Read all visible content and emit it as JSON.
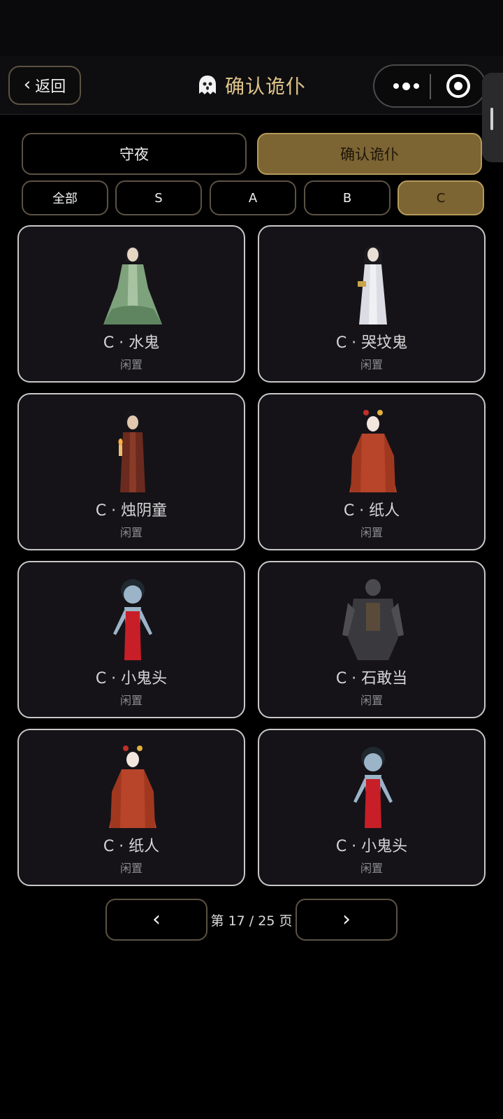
{
  "nav": {
    "back_icon": "‹",
    "back_label": "返回",
    "title": "确认诡仆",
    "title_icon": "ghost-icon"
  },
  "tabs": [
    {
      "label": "守夜",
      "active": false
    },
    {
      "label": "确认诡仆",
      "active": true
    }
  ],
  "filters": [
    {
      "label": "全部",
      "active": false
    },
    {
      "label": "S",
      "active": false
    },
    {
      "label": "A",
      "active": false
    },
    {
      "label": "B",
      "active": false
    },
    {
      "label": "C",
      "active": true
    }
  ],
  "cards": [
    {
      "name": "C · 水鬼",
      "status": "闲置"
    },
    {
      "name": "C · 哭坟鬼",
      "status": "闲置"
    },
    {
      "name": "C · 烛阴童",
      "status": "闲置"
    },
    {
      "name": "C · 纸人",
      "status": "闲置"
    },
    {
      "name": "C · 小鬼头",
      "status": "闲置"
    },
    {
      "name": "C · 石敢当",
      "status": "闲置"
    },
    {
      "name": "C · 纸人",
      "status": "闲置"
    },
    {
      "name": "C · 小鬼头",
      "status": "闲置"
    }
  ],
  "pagination": {
    "prev_label": "‹",
    "next_label": "›",
    "page_text": "第 17 / 25 页",
    "current": 17,
    "total": 25
  },
  "colors": {
    "accent_gold": "#7c6433",
    "title_gold": "#e0c48a",
    "card_bg": "#151318"
  }
}
